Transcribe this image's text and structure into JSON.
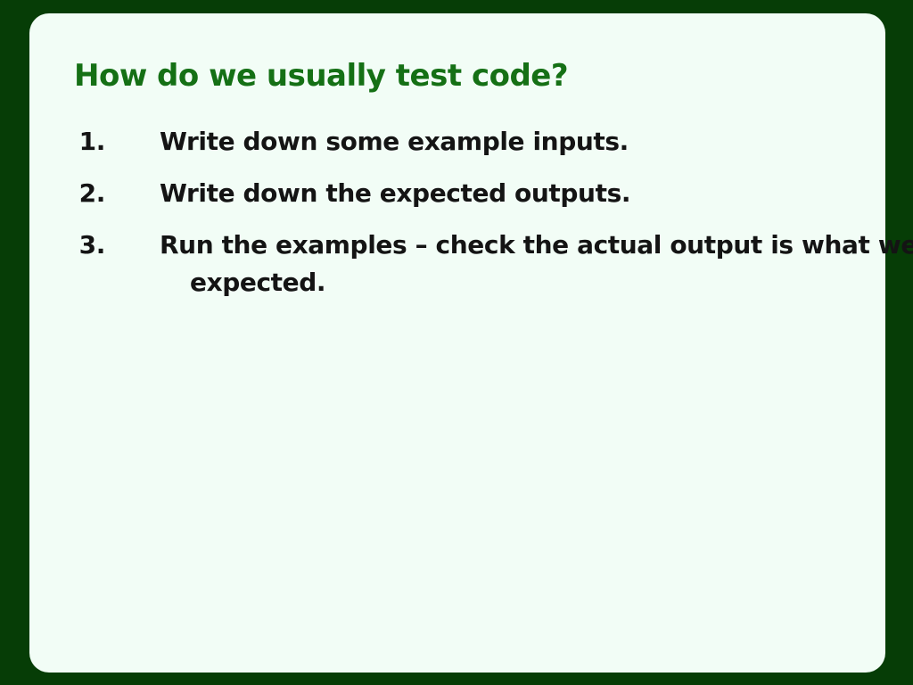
{
  "slide": {
    "title": "How do we usually test code?",
    "steps": [
      {
        "number": "1.",
        "text": "Write down some example inputs."
      },
      {
        "number": "2.",
        "text": "Write down the expected outputs."
      },
      {
        "number": "3.",
        "text": "Run the examples – check the actual output is what we",
        "continuation": "expected."
      }
    ]
  },
  "colors": {
    "frame": "#063d06",
    "panel": "#f2fdf6",
    "title": "#157015",
    "body_text": "#141414"
  }
}
